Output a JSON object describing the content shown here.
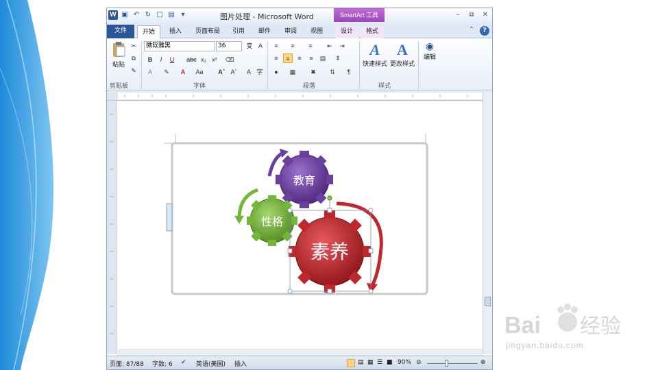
{
  "window": {
    "title": "图片处理 - Microsoft Word",
    "context_tab": "SmartArt 工具"
  },
  "tabs": [
    "文件",
    "开始",
    "插入",
    "页面布局",
    "引用",
    "邮件",
    "审阅",
    "视图",
    "设计",
    "格式"
  ],
  "ribbon": {
    "paste_label": "粘贴",
    "font_name": "微软雅黑",
    "font_size": "36",
    "quick_styles_label": "快速样式",
    "change_styles_label": "更改样式",
    "edit_label": "编辑",
    "group_clipboard": "剪贴板",
    "group_font": "字体",
    "group_paragraph": "段落",
    "group_styles": "样式"
  },
  "smartart": {
    "gear_top": "教育",
    "gear_left": "性格",
    "gear_main": "素养"
  },
  "status": {
    "page": "页面: 87/88",
    "words": "字数: 6",
    "language": "英语(美国)",
    "mode": "插入",
    "zoom": "90%"
  },
  "watermark": {
    "brand": "Baidu 经验",
    "url": "jingyan.baidu.com"
  },
  "colors": {
    "word_blue": "#2b579a",
    "smartart_purple": "#9a49b8",
    "gear_red": "#c0272d",
    "gear_green": "#74b63a",
    "gear_purple": "#6a3f9e"
  }
}
